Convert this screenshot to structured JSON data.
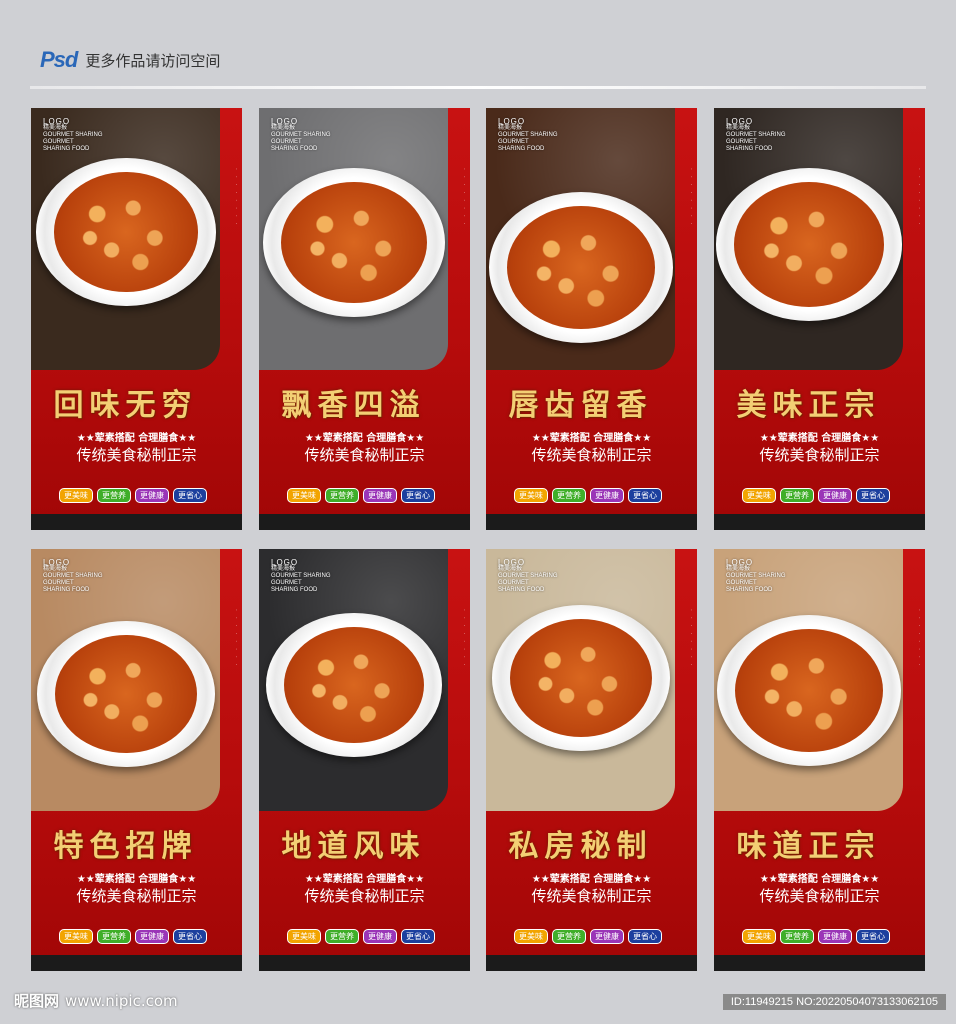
{
  "header": {
    "brand": "Psd",
    "tagline": "更多作品请访问空间"
  },
  "poster_common": {
    "logo": "LOGO",
    "logo_cn": "精美海报",
    "logo_en1": "GOURMET SHARING",
    "logo_en2": "GOURMET",
    "logo_en3": "SHARING FOOD",
    "subtitle1": "★★荤素搭配 合理膳食★★",
    "subtitle2": "传统美食秘制正宗",
    "tags": [
      "更美味",
      "更营养",
      "更健康",
      "更省心"
    ]
  },
  "posters": [
    {
      "title": "回味无穷",
      "bg": "#3a2a1e"
    },
    {
      "title": "飘香四溢",
      "bg": "#6e6e70"
    },
    {
      "title": "唇齿留香",
      "bg": "#4a2a1a"
    },
    {
      "title": "美味正宗",
      "bg": "#2f2722"
    },
    {
      "title": "特色招牌",
      "bg": "#b88a62"
    },
    {
      "title": "地道风味",
      "bg": "#2c2c2e"
    },
    {
      "title": "私房秘制",
      "bg": "#c9b89a"
    },
    {
      "title": "味道正宗",
      "bg": "#c8a27a"
    }
  ],
  "footer": {
    "site_cn": "昵图网",
    "site_url": "www.nipic.com",
    "image_id": "ID:11949215 NO:20220504073133062105"
  },
  "colors": {
    "poster_red": "#c81212",
    "title_gold": "#f3cf74",
    "page_bg": "#cfd0d4"
  }
}
